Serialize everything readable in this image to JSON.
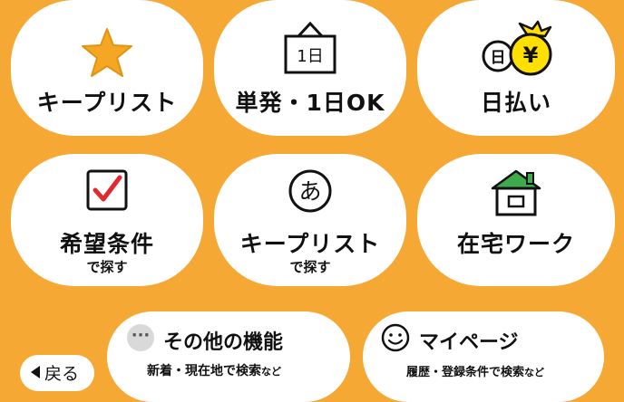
{
  "tiles": [
    {
      "title": "キープリスト",
      "sub": "",
      "icon": "star-icon"
    },
    {
      "title": "単発・1日OK",
      "sub": "",
      "icon": "calendar-1-day-icon",
      "icon_text": "1日"
    },
    {
      "title": "日払い",
      "sub": "",
      "icon": "daily-pay-coin-icon",
      "icon_text_day": "日",
      "icon_text_yen": "¥"
    },
    {
      "title": "希望条件",
      "sub": "で探す",
      "icon": "checkbox-icon"
    },
    {
      "title": "キープリスト",
      "sub": "で探す",
      "icon": "hiragana-a-icon",
      "icon_text": "あ"
    },
    {
      "title": "在宅ワーク",
      "sub": "",
      "icon": "house-icon"
    }
  ],
  "other": {
    "title": "その他の機能",
    "sub_main": "新着・現在地で検索",
    "sub_small": "など",
    "icon": "more-dots-icon",
    "icon_text": "···"
  },
  "mypage": {
    "title": "マイページ",
    "sub_main": "履歴・登録条件で検索",
    "sub_small": "など",
    "icon": "smiley-icon"
  },
  "back": {
    "label": "戻る"
  },
  "colors": {
    "background": "#F6A834",
    "star": "#F5A623",
    "check": "#E0282E",
    "house_roof": "#3DAA4B",
    "coin": "#FFE000"
  }
}
